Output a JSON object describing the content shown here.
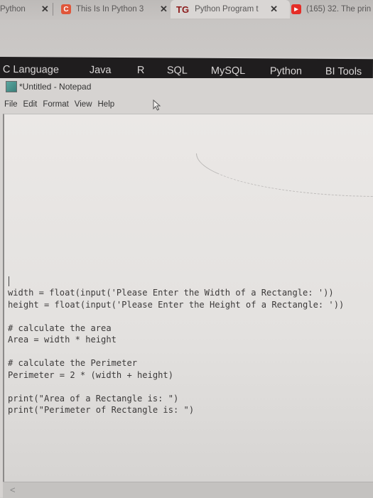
{
  "browser": {
    "tabs": [
      {
        "title": "Python",
        "favicon": "none",
        "active": false
      },
      {
        "title": "This Is In Python 3",
        "favicon": "C",
        "favicon_color": "#e0563a",
        "active": false
      },
      {
        "title": "Python Program t",
        "favicon": "TG",
        "favicon_color": "#8b1a1a",
        "active": true
      },
      {
        "title": "(165) 32. The prin",
        "favicon": "youtube",
        "favicon_color": "#e52d27",
        "active": false
      }
    ],
    "close_glyph": "✕"
  },
  "site_nav": {
    "items": [
      "C Language",
      "Java",
      "R",
      "SQL",
      "MySQL",
      "Python",
      "BI Tools"
    ]
  },
  "notepad": {
    "title": "*Untitled - Notepad",
    "menu": [
      "File",
      "Edit",
      "Format",
      "View",
      "Help"
    ],
    "code_lines": [
      "width = float(input('Please Enter the Width of a Rectangle: '))",
      "height = float(input('Please Enter the Height of a Rectangle: '))",
      "",
      "# calculate the area",
      "Area = width * height",
      "",
      "# calculate the Perimeter",
      "Perimeter = 2 * (width + height)",
      "",
      "print(\"Area of a Rectangle is: \")",
      "print(\"Perimeter of Rectangle is: \")"
    ],
    "scroll_left_glyph": "<"
  }
}
